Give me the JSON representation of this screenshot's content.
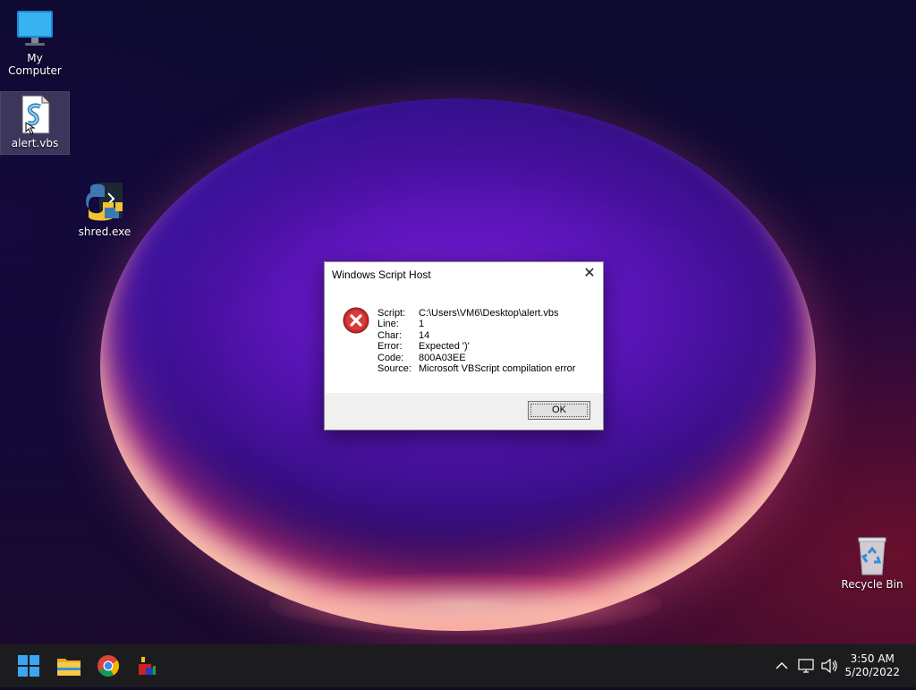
{
  "desktop": {
    "icons": [
      {
        "label": "My Computer",
        "icon": "monitor-icon"
      },
      {
        "label": "alert.vbs",
        "icon": "vbs-script-icon",
        "selected": true
      },
      {
        "label": "shred.exe",
        "icon": "python-exe-icon"
      },
      {
        "label": "Recycle Bin",
        "icon": "recycle-bin-icon"
      }
    ]
  },
  "dialog": {
    "title": "Windows Script Host",
    "close_glyph": "✕",
    "icon": "error-icon",
    "rows": [
      {
        "key": "Script:",
        "value": "C:\\Users\\VM6\\Desktop\\alert.vbs"
      },
      {
        "key": "Line:",
        "value": "1"
      },
      {
        "key": "Char:",
        "value": "14"
      },
      {
        "key": "Error:",
        "value": "Expected ')'"
      },
      {
        "key": "Code:",
        "value": "800A03EE"
      },
      {
        "key": "Source:",
        "value": "Microsoft VBScript compilation error"
      }
    ],
    "ok_label": "OK"
  },
  "taskbar": {
    "apps": [
      {
        "name": "start-button",
        "icon": "windows-logo-icon"
      },
      {
        "name": "file-explorer",
        "icon": "folder-icon"
      },
      {
        "name": "chrome",
        "icon": "chrome-icon"
      },
      {
        "name": "app",
        "icon": "app-icon"
      }
    ],
    "tray": {
      "chevron": "^",
      "icons": [
        "network-icon",
        "speaker-icon"
      ]
    },
    "clock": {
      "time": "3:50 AM",
      "date": "5/20/2022"
    }
  },
  "colors": {
    "taskbar": "#1c1c1e",
    "error_red": "#c42b2b",
    "accent_blue": "#0078d4"
  }
}
